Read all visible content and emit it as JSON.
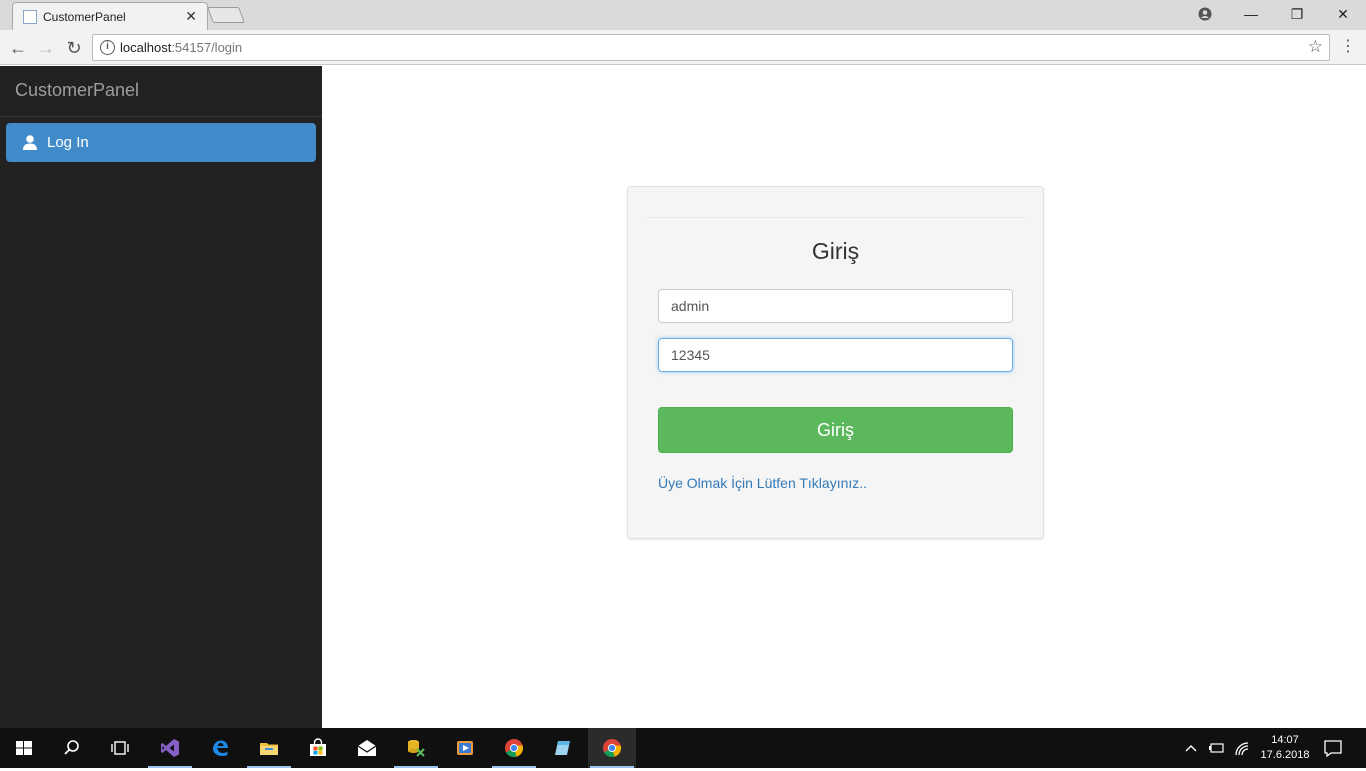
{
  "browser": {
    "tab_title": "CustomerPanel",
    "url_host": "localhost",
    "url_rest": ":54157/login"
  },
  "sidebar": {
    "brand": "CustomerPanel",
    "items": [
      {
        "label": "Log In",
        "icon": "user-icon",
        "active": true
      }
    ],
    "active_color": "#428bca"
  },
  "login": {
    "title": "Giriş",
    "username_value": "admin",
    "password_value": "12345",
    "submit_label": "Giriş",
    "register_link": "Üye Olmak İçin Lütfen Tıklayınız..",
    "submit_color": "#5cb85c",
    "link_color": "#337ab7"
  },
  "taskbar": {
    "time": "14:07",
    "date": "17.6.2018"
  }
}
